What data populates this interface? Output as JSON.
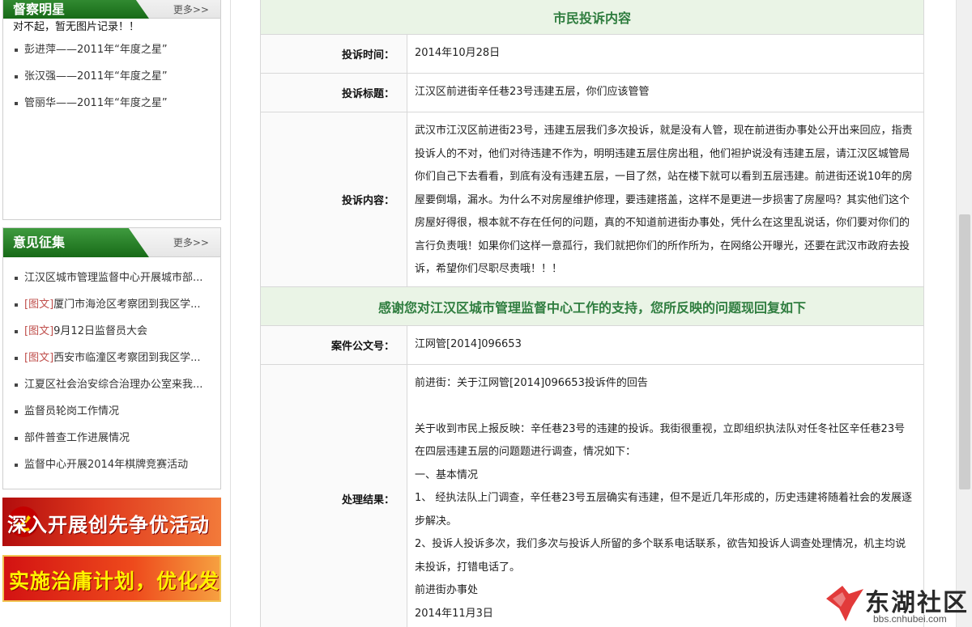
{
  "sidebar": {
    "stars_panel": {
      "title": "督察明星",
      "more": "更多>>",
      "empty_msg": "对不起，暂无图片记录！！",
      "items": [
        "彭进萍——2011年“年度之星”",
        "张汉强——2011年“年度之星”",
        "管丽华——2011年“年度之星”"
      ]
    },
    "opinion_panel": {
      "title": "意见征集",
      "more": "更多>>",
      "items": [
        {
          "tag": "",
          "text": "江汉区城市管理监督中心开展城市部..."
        },
        {
          "tag": "[图文]",
          "text": "厦门市海沧区考察团到我区学..."
        },
        {
          "tag": "[图文]",
          "text": "9月12日监督员大会"
        },
        {
          "tag": "[图文]",
          "text": "西安市临潼区考察团到我区学..."
        },
        {
          "tag": "",
          "text": "江夏区社会治安综合治理办公室来我..."
        },
        {
          "tag": "",
          "text": "监督员轮岗工作情况"
        },
        {
          "tag": "",
          "text": "部件普查工作进展情况"
        },
        {
          "tag": "",
          "text": "监督中心开展2014年棋牌竞赛活动"
        }
      ]
    },
    "banners": [
      "深入开展创先争优活动",
      "实施治庸计划，优化发展环境"
    ]
  },
  "complaint": {
    "section_title": "市民投诉内容",
    "time_label": "投诉时间：",
    "time_value": "2014年10月28日",
    "title_label": "投诉标题：",
    "title_value": "江汉区前进街辛任巷23号违建五层，你们应该管管",
    "content_label": "投诉内容：",
    "content_value": "武汉市江汉区前进街23号，违建五层我们多次投诉，就是没有人管，现在前进街办事处公开出来回应，指责投诉人的不对，他们对待违建不作为，明明违建五层住房出租，他们袒护说没有违建五层，请江汉区城管局你们自己下去看看，到底有没有违建五层，一目了然，站在楼下就可以看到五层违建。前进街还说10年的房屋要倒塌，漏水。为什么不对房屋维护修理，要违建搭盖，这样不是更进一步损害了房屋吗？其实他们这个房屋好得很，根本就不存在任何的问题，真的不知道前进街办事处，凭什么在这里乱说话，你们要对你们的言行负责哦！如果你们这样一意孤行，我们就把你们的所作所为，在网络公开曝光，还要在武汉市政府去投诉，希望你们尽职尽责哦！！！"
  },
  "reply": {
    "section_title": "感谢您对江汉区城市管理监督中心工作的支持，您所反映的问题现回复如下",
    "case_label": "案件公文号：",
    "case_value": "江网管[2014]096653",
    "result_label": "处理结果：",
    "result_lines": [
      "前进街：关于江网管[2014]096653投诉件的回告",
      "",
      "关于收到市民上报反映：辛任巷23号的违建的投诉。我街很重视，立即组织执法队对任冬社区辛任巷23号在四层违建五层的问题题进行调查，情况如下：",
      "一、基本情况",
      "1、 经执法队上门调查，辛任巷23号五层确实有违建，但不是近几年形成的，历史违建将随着社会的发展逐步解决。",
      "2、投诉人投诉多次，我们多次与投诉人所留的多个联系电话联系，欲告知投诉人调查处理情况，机主均说未投诉，打错电话了。",
      "前进街办事处",
      "2014年11月3日"
    ]
  },
  "watermark": {
    "name": "东湖社区",
    "url": "bbs.cnhubei.com"
  },
  "colors": {
    "green": "#2f7d3f",
    "section_bg": "#eaf4e6",
    "tag": "#c0504d"
  }
}
